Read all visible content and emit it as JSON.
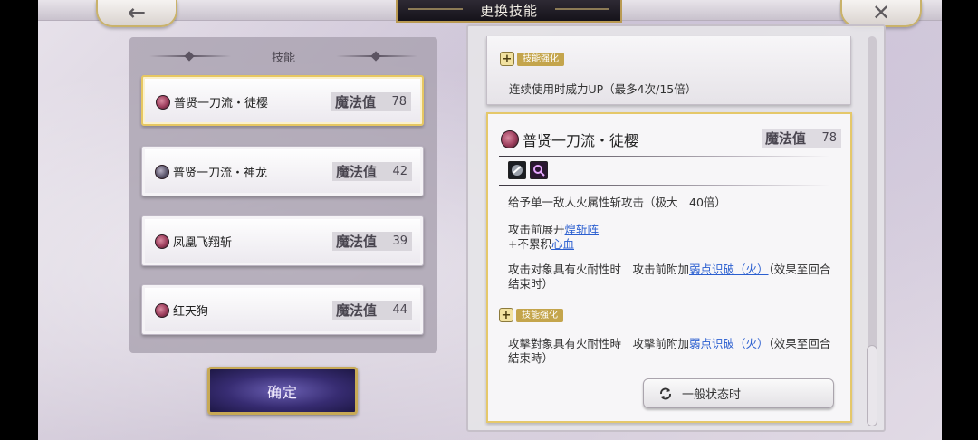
{
  "header": {
    "title": "更换技能",
    "back_glyph": "←",
    "close_glyph": "✕"
  },
  "skill_list": {
    "header": "技能",
    "items": [
      {
        "name": "普贤一刀流・徒樱",
        "mp_label": "魔法值",
        "mp": "78",
        "selected": true,
        "orb": "pink"
      },
      {
        "name": "普贤一刀流・神龙",
        "mp_label": "魔法值",
        "mp": "42",
        "selected": false,
        "orb": "dark"
      },
      {
        "name": "凤凰飞翔斩",
        "mp_label": "魔法值",
        "mp": "39",
        "selected": false,
        "orb": "pink"
      },
      {
        "name": "红天狗",
        "mp_label": "魔法值",
        "mp": "44",
        "selected": false,
        "orb": "pink"
      }
    ]
  },
  "confirm_label": "确定",
  "previous_card": {
    "badge": "技能强化",
    "text": "连续使用时威力UP（最多4次/15倍）"
  },
  "detail": {
    "title": "普贤一刀流・徒樱",
    "mp_label": "魔法值",
    "mp": "78",
    "icons": [
      "attack-type-icon",
      "weak-point-icon"
    ],
    "line1": "给予单一敌人火属性斩攻击（极大　40倍）",
    "line2_prefix": "攻击前展开",
    "line2_link": "煌斩阵",
    "line3_prefix": "+不累积",
    "line3_link": "心血",
    "line4_prefix": "攻击对象具有火耐性时　攻击前附加",
    "line4_link": "弱点识破（火）",
    "line4_suffix": "（效果至回合结束时）",
    "badge": "技能强化",
    "line5_prefix": "攻擊對象具有火耐性時　攻擊前附加",
    "line5_link": "弱点识破（火）",
    "line5_suffix": "（效果至回合結束時）",
    "mode_button": "一般状态时"
  }
}
